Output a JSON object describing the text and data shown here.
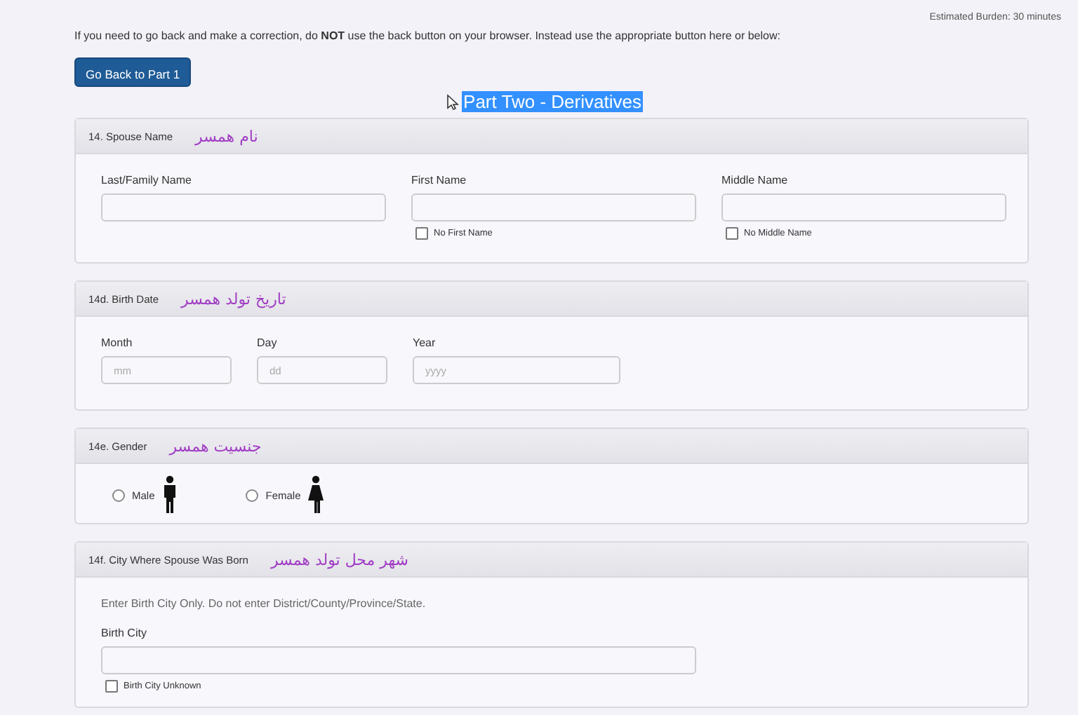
{
  "header": {
    "burden": "Estimated Burden: 30 minutes",
    "notice": "If you need to go back and make a correction, do **NOT** use the back button on your browser. Instead use the appropriate button here or below:",
    "back_button": "Go Back to Part 1",
    "part_title": "Part Two - Derivatives"
  },
  "sections": [
    {
      "kind": "names",
      "number": "14. Spouse Name",
      "annotation": "نام همسر",
      "fields": [
        {
          "label": "Last/Family Name"
        },
        {
          "label": "First Name",
          "checkbox": {
            "label": "No First Name",
            "checked": false
          }
        },
        {
          "label": "Middle Name",
          "checkbox": {
            "label": "No Middle Name",
            "checked": false
          }
        }
      ]
    },
    {
      "kind": "date",
      "number": "14d. Birth Date",
      "annotation": "تاریخ تولد همسر",
      "fields": [
        {
          "label": "Month",
          "placeholder": "mm"
        },
        {
          "label": "Day",
          "placeholder": "dd"
        },
        {
          "label": "Year",
          "placeholder": "yyyy"
        }
      ]
    },
    {
      "kind": "gender",
      "number": "14e. Gender",
      "annotation": "جنسیت همسر",
      "options": [
        {
          "label": "Male",
          "kind": "male",
          "selected": false
        },
        {
          "label": "Female",
          "kind": "female",
          "selected": false
        }
      ]
    },
    {
      "kind": "city",
      "number": "14f. City Where Spouse Was Born",
      "annotation": "شهر محل تولد همسر",
      "note": "Enter Birth City Only. Do not enter District/County/Province/State.",
      "fields": [
        {
          "label": "Birth City",
          "checkbox": {
            "label": "Birth City Unknown",
            "checked": false
          }
        }
      ]
    }
  ]
}
